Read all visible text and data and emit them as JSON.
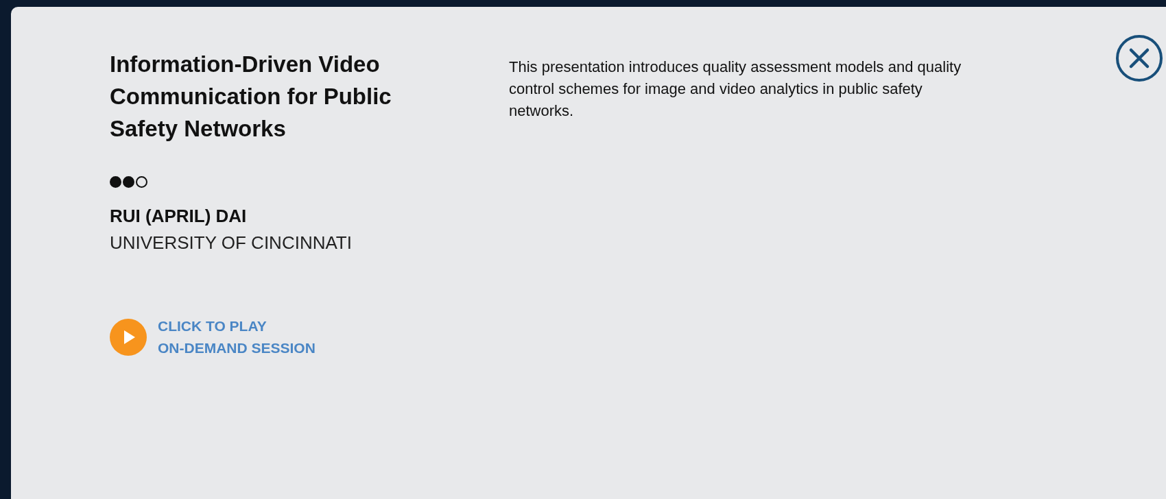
{
  "session": {
    "title": "Information-Driven Video Communication for Public Safety Networks",
    "description": "This presentation introduces quality assessment models and quality control schemes for image and video analytics in public safety networks.",
    "stars": 2,
    "speaker": "RUI (APRIL) DAI",
    "affiliation": "UNIVERSITY OF CINCINNATI",
    "play_lines": [
      "CLICK TO PLAY",
      "ON-DEMAND SESSION"
    ]
  }
}
